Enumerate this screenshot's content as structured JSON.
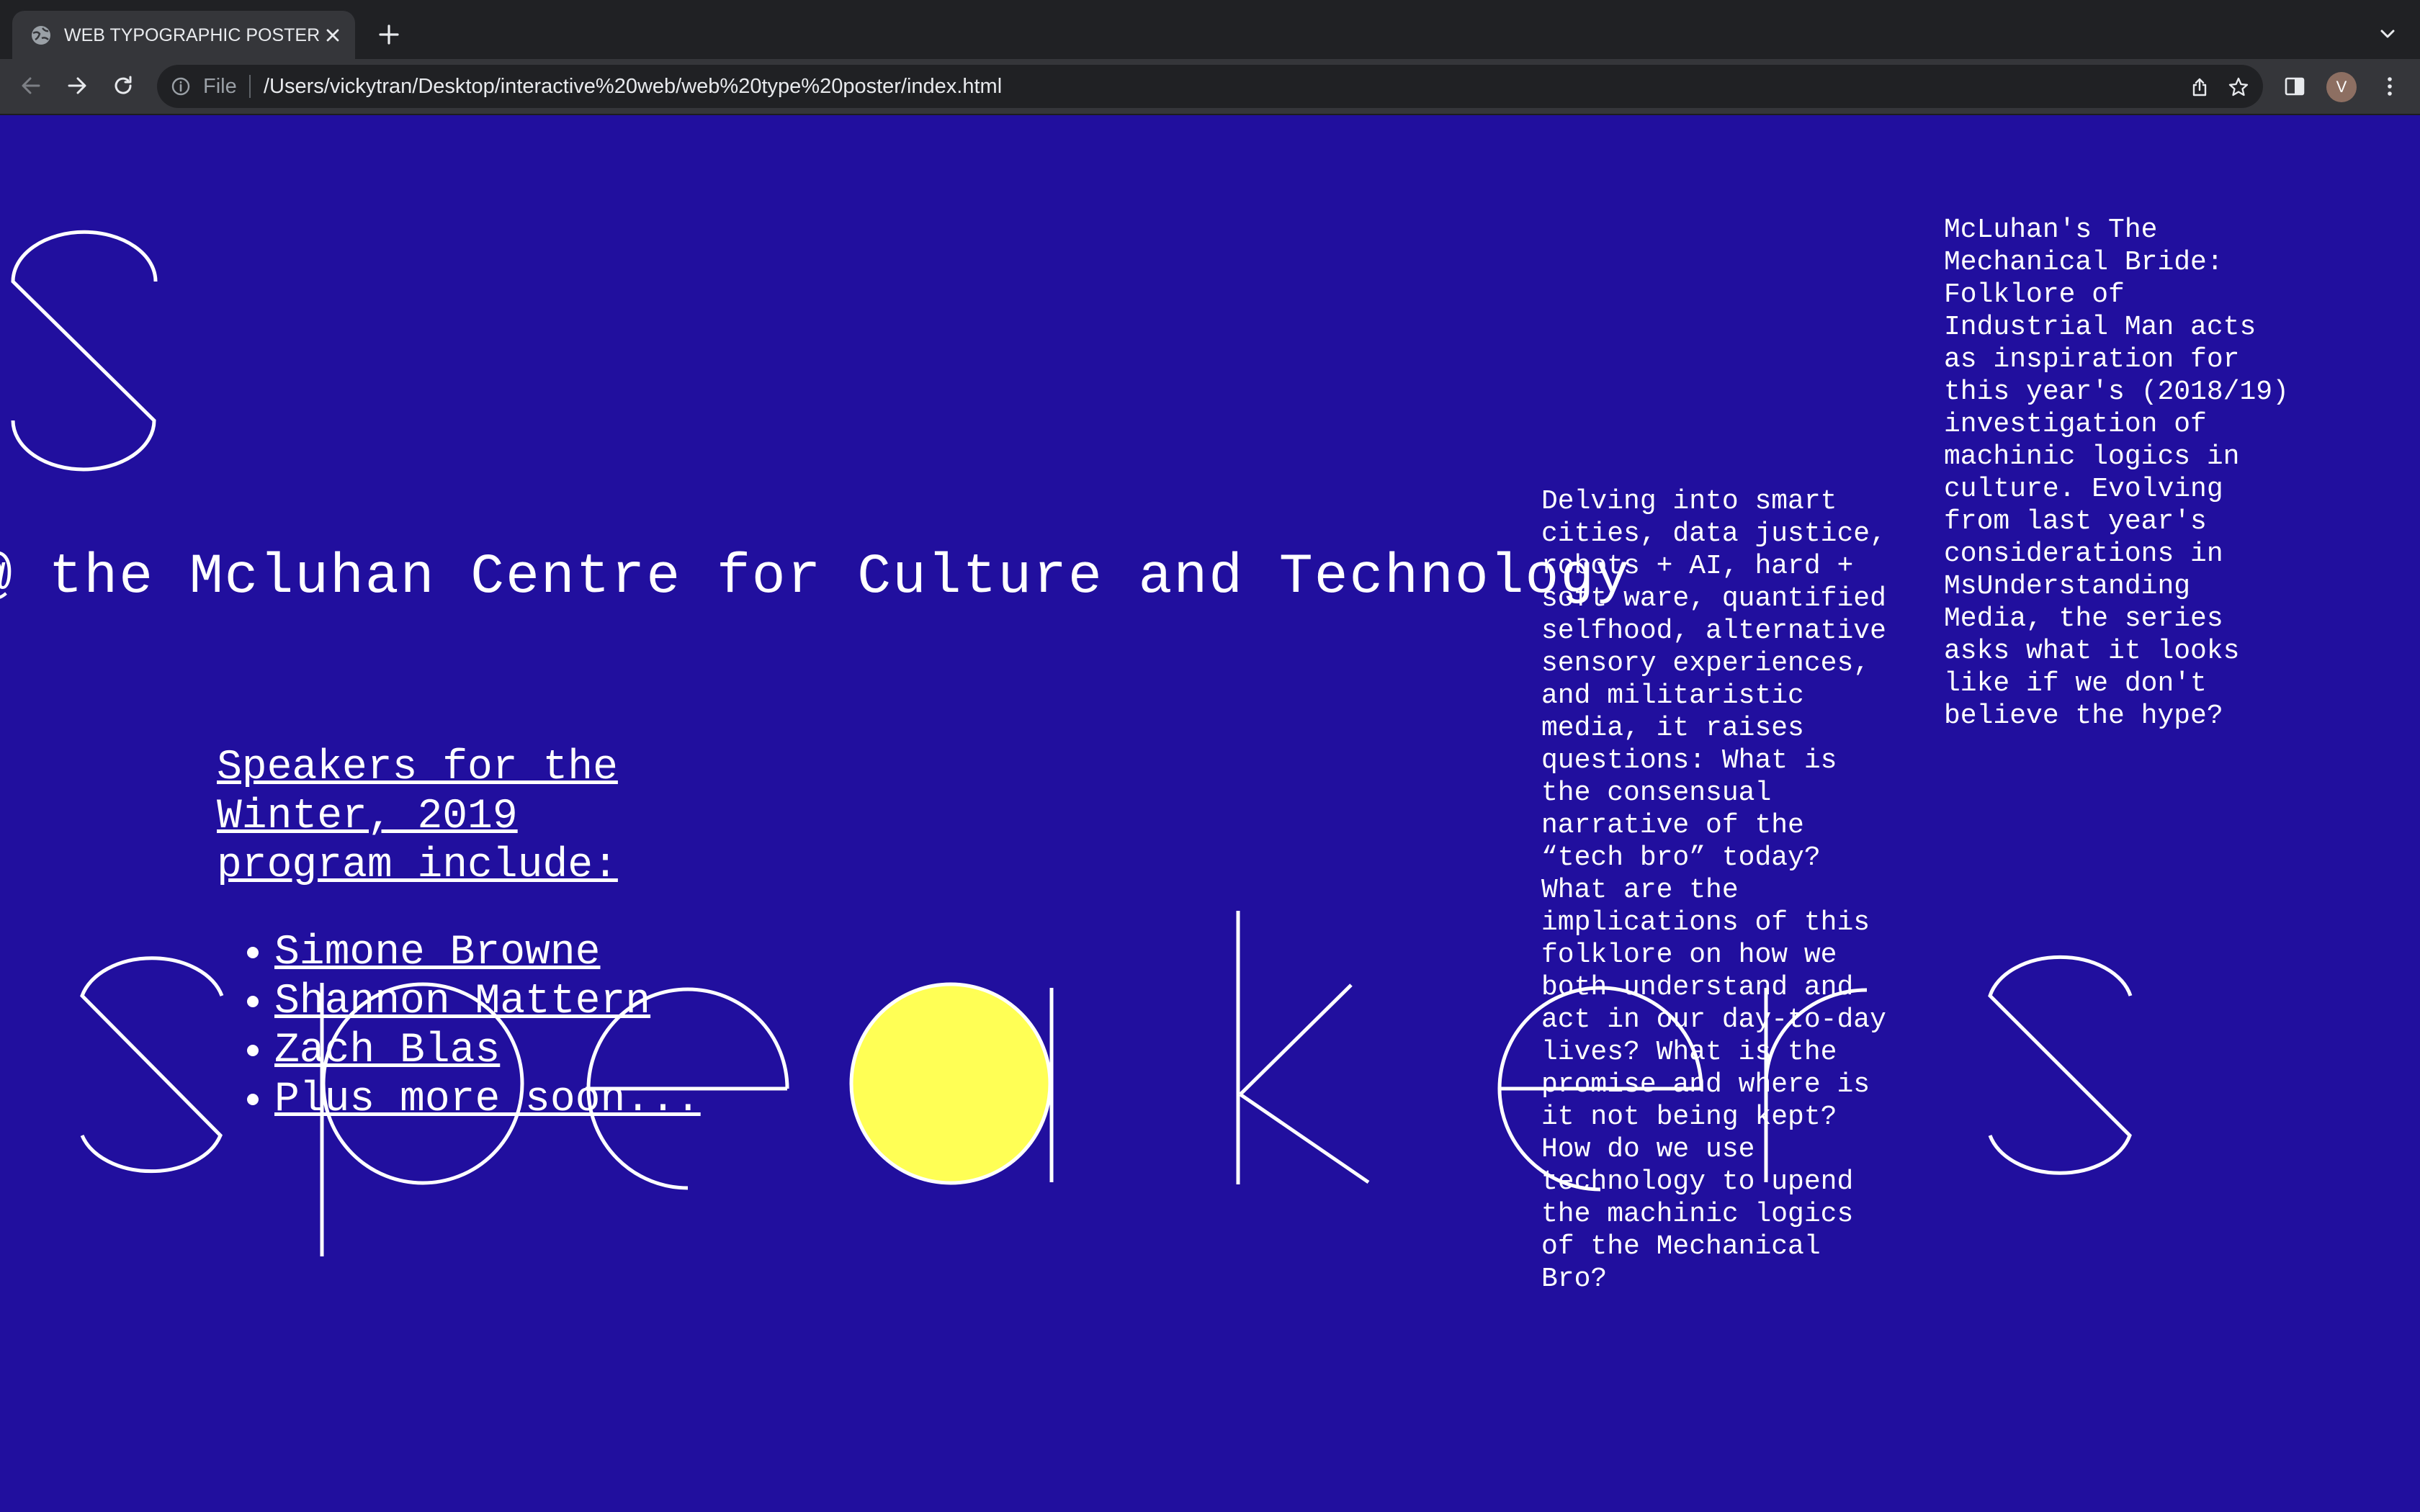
{
  "browser": {
    "tab": {
      "title": "WEB TYPOGRAPHIC POSTER"
    },
    "address": {
      "scheme": "File",
      "url": "/Users/vickytran/Desktop/interactive%20web/web%20type%20poster/index.html"
    },
    "profile_initial": "V",
    "icons": [
      "globe-icon",
      "close-icon",
      "plus-icon",
      "chevron-down-icon",
      "back-arrow-icon",
      "forward-arrow-icon",
      "reload-icon",
      "info-icon",
      "share-icon",
      "star-icon",
      "side-panel-icon",
      "kebab-menu-icon"
    ]
  },
  "poster": {
    "colors": {
      "background": "#210f9e",
      "text": "#ffffff",
      "accent": "#ffff55"
    },
    "headline": "@ the Mcluhan Centre for Culture and Technology",
    "speakers_heading": "Speakers for the Winter, 2019 program include:",
    "speakers": [
      "Simone Browne",
      "Shannon Mattern",
      "Zach Blas",
      "Plus more soon..."
    ],
    "display_word": "speakers",
    "delving_text": "Delving into smart\ncities, data justice,\nrobots + AI, hard +\nsoft ware, quantified\nselfhood, alternative\nsensory experiences,\nand militaristic\nmedia, it raises\nquestions: What is\nthe consensual\nnarrative of the\n“tech bro” today?\nWhat are the\nimplications of this\nfolklore on how we\nboth understand and\nact in our day-to-day\nlives? What is the\npromise and where is\nit not being kept?\nHow do we use\ntechnology to upend\nthe machinic logics\nof the Mechanical\nBro?",
    "mcluhan_text": "McLuhan's The\nMechanical Bride:\nFolklore of\nIndustrial Man acts\nas inspiration for\nthis year's (2018/19)\ninvestigation of\nmachinic logics in\nculture. Evolving\nfrom last year's\nconsiderations in\nMsUnderstanding\nMedia, the series\nasks what it looks\nlike if we don't\nbelieve the hype?"
  }
}
